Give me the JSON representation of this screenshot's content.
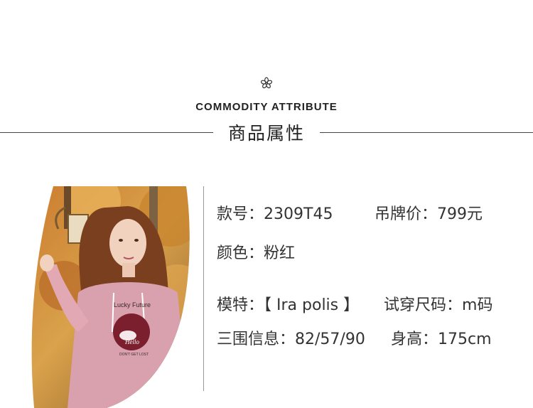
{
  "header": {
    "subtitle_en": "COMMODITY ATTRIBUTE",
    "title_cn": "商品属性"
  },
  "photo": {
    "hoodie_text_top": "Lucky Future",
    "hoodie_text_sign": "Hello",
    "hoodie_text_bottom": "DON'T GET LOST"
  },
  "attributes": {
    "style_no_label": "款号：",
    "style_no_value": "2309T45",
    "price_label": "吊牌价：",
    "price_value": "799元",
    "color_label": "颜色：",
    "color_value": "粉红",
    "model_label": "模特：",
    "model_value": "【 Ira polis 】",
    "size_label": "试穿尺码：",
    "size_value": "m码",
    "measure_label": "三围信息：",
    "measure_value": "82/57/90",
    "height_label": "身高：",
    "height_value": "175cm"
  }
}
